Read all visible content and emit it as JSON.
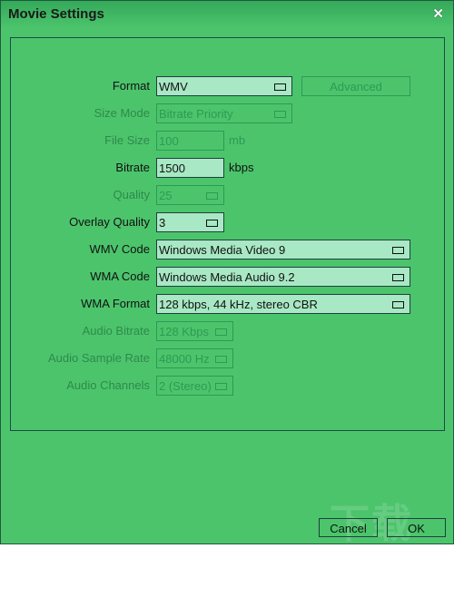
{
  "title": "Movie Settings",
  "buttons": {
    "advanced": "Advanced",
    "cancel": "Cancel",
    "ok": "OK"
  },
  "fields": [
    {
      "label": "Format",
      "value": "WMV",
      "enabled": true,
      "dropdown": true
    },
    {
      "label": "Size Mode",
      "value": "Bitrate Priority",
      "enabled": false,
      "dropdown": true
    },
    {
      "label": "File Size",
      "value": "100",
      "unit": "mb",
      "enabled": false,
      "dropdown": false
    },
    {
      "label": "Bitrate",
      "value": "1500",
      "unit": "kbps",
      "enabled": true,
      "dropdown": false
    },
    {
      "label": "Quality",
      "value": "25",
      "enabled": false,
      "dropdown": true
    },
    {
      "label": "Overlay Quality",
      "value": "3",
      "enabled": true,
      "dropdown": true
    },
    {
      "label": "WMV Code",
      "value": "Windows Media Video 9",
      "enabled": true,
      "dropdown": true
    },
    {
      "label": "WMA Code",
      "value": "Windows Media Audio 9.2",
      "enabled": true,
      "dropdown": true
    },
    {
      "label": "WMA Format",
      "value": "128 kbps, 44 kHz, stereo CBR",
      "enabled": true,
      "dropdown": true
    },
    {
      "label": "Audio Bitrate",
      "value": "128 Kbps",
      "enabled": false,
      "dropdown": true
    },
    {
      "label": "Audio Sample Rate",
      "value": "48000 Hz",
      "enabled": false,
      "dropdown": true
    },
    {
      "label": "Audio Channels",
      "value": "2 (Stereo)",
      "enabled": false,
      "dropdown": true
    }
  ],
  "watermark": "下载吧"
}
